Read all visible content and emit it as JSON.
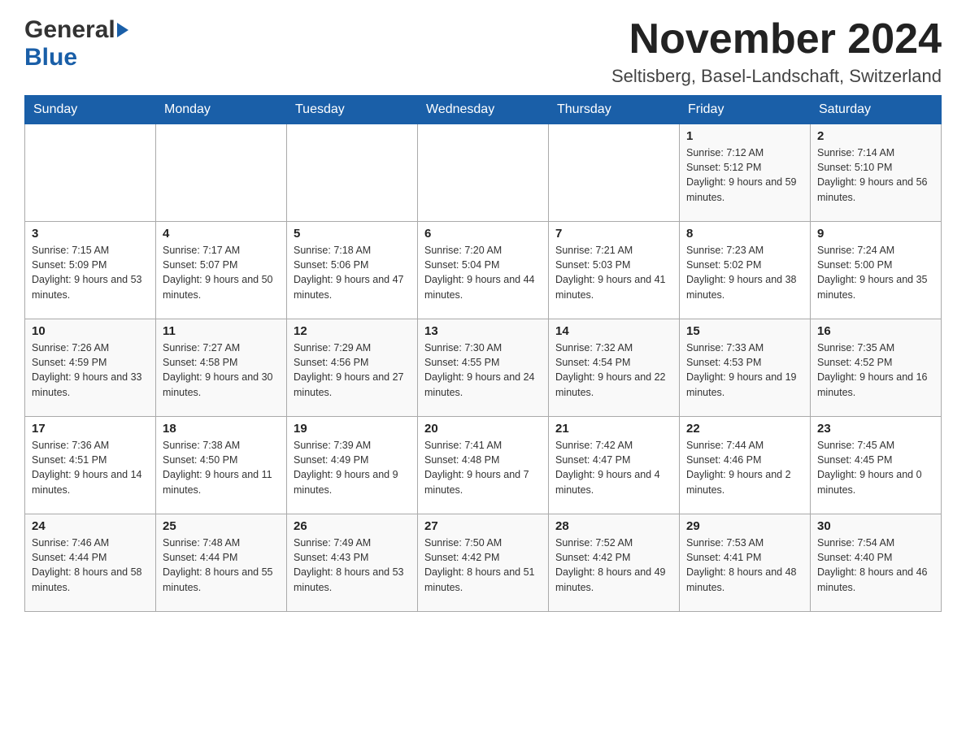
{
  "logo": {
    "general": "General",
    "blue": "Blue"
  },
  "header": {
    "month": "November 2024",
    "location": "Seltisberg, Basel-Landschaft, Switzerland"
  },
  "days_of_week": [
    "Sunday",
    "Monday",
    "Tuesday",
    "Wednesday",
    "Thursday",
    "Friday",
    "Saturday"
  ],
  "weeks": [
    [
      {
        "day": "",
        "sunrise": "",
        "sunset": "",
        "daylight": ""
      },
      {
        "day": "",
        "sunrise": "",
        "sunset": "",
        "daylight": ""
      },
      {
        "day": "",
        "sunrise": "",
        "sunset": "",
        "daylight": ""
      },
      {
        "day": "",
        "sunrise": "",
        "sunset": "",
        "daylight": ""
      },
      {
        "day": "",
        "sunrise": "",
        "sunset": "",
        "daylight": ""
      },
      {
        "day": "1",
        "sunrise": "Sunrise: 7:12 AM",
        "sunset": "Sunset: 5:12 PM",
        "daylight": "Daylight: 9 hours and 59 minutes."
      },
      {
        "day": "2",
        "sunrise": "Sunrise: 7:14 AM",
        "sunset": "Sunset: 5:10 PM",
        "daylight": "Daylight: 9 hours and 56 minutes."
      }
    ],
    [
      {
        "day": "3",
        "sunrise": "Sunrise: 7:15 AM",
        "sunset": "Sunset: 5:09 PM",
        "daylight": "Daylight: 9 hours and 53 minutes."
      },
      {
        "day": "4",
        "sunrise": "Sunrise: 7:17 AM",
        "sunset": "Sunset: 5:07 PM",
        "daylight": "Daylight: 9 hours and 50 minutes."
      },
      {
        "day": "5",
        "sunrise": "Sunrise: 7:18 AM",
        "sunset": "Sunset: 5:06 PM",
        "daylight": "Daylight: 9 hours and 47 minutes."
      },
      {
        "day": "6",
        "sunrise": "Sunrise: 7:20 AM",
        "sunset": "Sunset: 5:04 PM",
        "daylight": "Daylight: 9 hours and 44 minutes."
      },
      {
        "day": "7",
        "sunrise": "Sunrise: 7:21 AM",
        "sunset": "Sunset: 5:03 PM",
        "daylight": "Daylight: 9 hours and 41 minutes."
      },
      {
        "day": "8",
        "sunrise": "Sunrise: 7:23 AM",
        "sunset": "Sunset: 5:02 PM",
        "daylight": "Daylight: 9 hours and 38 minutes."
      },
      {
        "day": "9",
        "sunrise": "Sunrise: 7:24 AM",
        "sunset": "Sunset: 5:00 PM",
        "daylight": "Daylight: 9 hours and 35 minutes."
      }
    ],
    [
      {
        "day": "10",
        "sunrise": "Sunrise: 7:26 AM",
        "sunset": "Sunset: 4:59 PM",
        "daylight": "Daylight: 9 hours and 33 minutes."
      },
      {
        "day": "11",
        "sunrise": "Sunrise: 7:27 AM",
        "sunset": "Sunset: 4:58 PM",
        "daylight": "Daylight: 9 hours and 30 minutes."
      },
      {
        "day": "12",
        "sunrise": "Sunrise: 7:29 AM",
        "sunset": "Sunset: 4:56 PM",
        "daylight": "Daylight: 9 hours and 27 minutes."
      },
      {
        "day": "13",
        "sunrise": "Sunrise: 7:30 AM",
        "sunset": "Sunset: 4:55 PM",
        "daylight": "Daylight: 9 hours and 24 minutes."
      },
      {
        "day": "14",
        "sunrise": "Sunrise: 7:32 AM",
        "sunset": "Sunset: 4:54 PM",
        "daylight": "Daylight: 9 hours and 22 minutes."
      },
      {
        "day": "15",
        "sunrise": "Sunrise: 7:33 AM",
        "sunset": "Sunset: 4:53 PM",
        "daylight": "Daylight: 9 hours and 19 minutes."
      },
      {
        "day": "16",
        "sunrise": "Sunrise: 7:35 AM",
        "sunset": "Sunset: 4:52 PM",
        "daylight": "Daylight: 9 hours and 16 minutes."
      }
    ],
    [
      {
        "day": "17",
        "sunrise": "Sunrise: 7:36 AM",
        "sunset": "Sunset: 4:51 PM",
        "daylight": "Daylight: 9 hours and 14 minutes."
      },
      {
        "day": "18",
        "sunrise": "Sunrise: 7:38 AM",
        "sunset": "Sunset: 4:50 PM",
        "daylight": "Daylight: 9 hours and 11 minutes."
      },
      {
        "day": "19",
        "sunrise": "Sunrise: 7:39 AM",
        "sunset": "Sunset: 4:49 PM",
        "daylight": "Daylight: 9 hours and 9 minutes."
      },
      {
        "day": "20",
        "sunrise": "Sunrise: 7:41 AM",
        "sunset": "Sunset: 4:48 PM",
        "daylight": "Daylight: 9 hours and 7 minutes."
      },
      {
        "day": "21",
        "sunrise": "Sunrise: 7:42 AM",
        "sunset": "Sunset: 4:47 PM",
        "daylight": "Daylight: 9 hours and 4 minutes."
      },
      {
        "day": "22",
        "sunrise": "Sunrise: 7:44 AM",
        "sunset": "Sunset: 4:46 PM",
        "daylight": "Daylight: 9 hours and 2 minutes."
      },
      {
        "day": "23",
        "sunrise": "Sunrise: 7:45 AM",
        "sunset": "Sunset: 4:45 PM",
        "daylight": "Daylight: 9 hours and 0 minutes."
      }
    ],
    [
      {
        "day": "24",
        "sunrise": "Sunrise: 7:46 AM",
        "sunset": "Sunset: 4:44 PM",
        "daylight": "Daylight: 8 hours and 58 minutes."
      },
      {
        "day": "25",
        "sunrise": "Sunrise: 7:48 AM",
        "sunset": "Sunset: 4:44 PM",
        "daylight": "Daylight: 8 hours and 55 minutes."
      },
      {
        "day": "26",
        "sunrise": "Sunrise: 7:49 AM",
        "sunset": "Sunset: 4:43 PM",
        "daylight": "Daylight: 8 hours and 53 minutes."
      },
      {
        "day": "27",
        "sunrise": "Sunrise: 7:50 AM",
        "sunset": "Sunset: 4:42 PM",
        "daylight": "Daylight: 8 hours and 51 minutes."
      },
      {
        "day": "28",
        "sunrise": "Sunrise: 7:52 AM",
        "sunset": "Sunset: 4:42 PM",
        "daylight": "Daylight: 8 hours and 49 minutes."
      },
      {
        "day": "29",
        "sunrise": "Sunrise: 7:53 AM",
        "sunset": "Sunset: 4:41 PM",
        "daylight": "Daylight: 8 hours and 48 minutes."
      },
      {
        "day": "30",
        "sunrise": "Sunrise: 7:54 AM",
        "sunset": "Sunset: 4:40 PM",
        "daylight": "Daylight: 8 hours and 46 minutes."
      }
    ]
  ]
}
